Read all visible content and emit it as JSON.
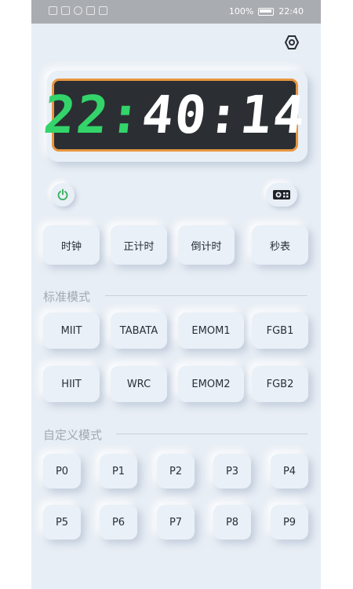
{
  "status_bar": {
    "battery_text": "100%",
    "time": "22:40"
  },
  "clock": {
    "hours": "22:",
    "minutes_seconds": "40:14"
  },
  "icons": {
    "settings": "settings-icon",
    "power": "power-icon",
    "radio": "radio-icon"
  },
  "colors": {
    "accent_green": "#33d46a",
    "bezel_orange": "#e89640",
    "screen_dark": "#2b2f33"
  },
  "modes": [
    "时钟",
    "正计时",
    "倒计时",
    "秒表"
  ],
  "standard": {
    "title": "标准模式",
    "buttons": [
      "MIIT",
      "TABATA",
      "EMOM1",
      "FGB1",
      "HIIT",
      "WRC",
      "EMOM2",
      "FGB2"
    ]
  },
  "custom": {
    "title": "自定义模式",
    "buttons": [
      "P0",
      "P1",
      "P2",
      "P3",
      "P4",
      "P5",
      "P6",
      "P7",
      "P8",
      "P9"
    ]
  }
}
